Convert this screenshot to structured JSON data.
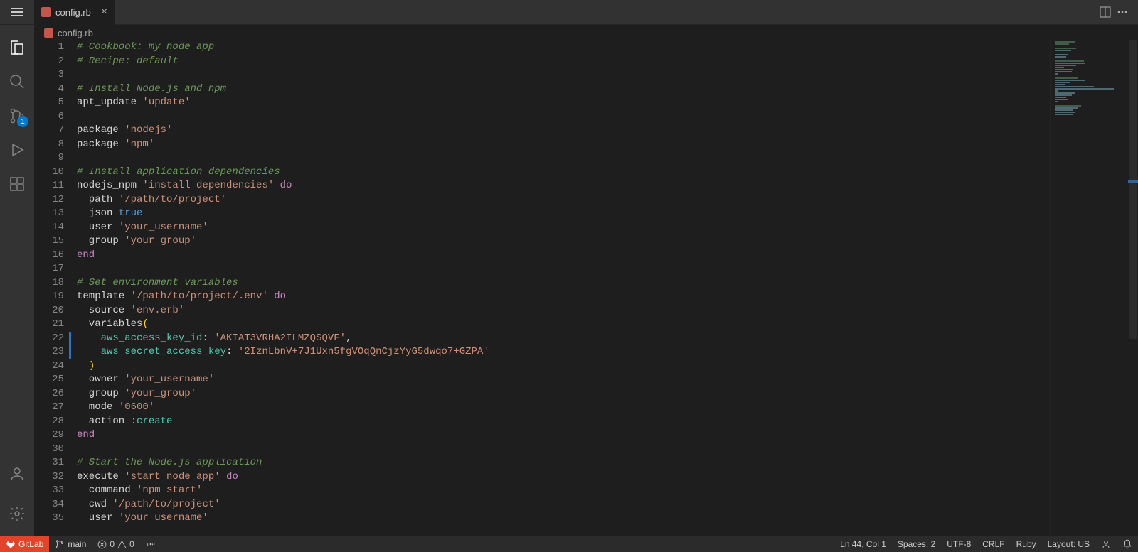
{
  "tab": {
    "filename": "config.rb"
  },
  "breadcrumb": {
    "filename": "config.rb"
  },
  "activitybar": {
    "source_control_badge": "1"
  },
  "statusbar": {
    "gitlab": "GitLab",
    "branch": "main",
    "errors": "0",
    "warnings": "0",
    "cursor": "Ln 44, Col 1",
    "spaces": "Spaces: 2",
    "encoding": "UTF-8",
    "eol": "CRLF",
    "language": "Ruby",
    "layout": "Layout: US"
  },
  "code": [
    {
      "n": 1,
      "t": [
        {
          "c": "c-comment",
          "s": "# Cookbook: my_node_app"
        }
      ]
    },
    {
      "n": 2,
      "t": [
        {
          "c": "c-comment",
          "s": "# Recipe: default"
        }
      ]
    },
    {
      "n": 3,
      "t": []
    },
    {
      "n": 4,
      "t": [
        {
          "c": "c-comment",
          "s": "# Install Node.js and npm"
        }
      ]
    },
    {
      "n": 5,
      "t": [
        {
          "c": "c-ident",
          "s": "apt_update "
        },
        {
          "c": "c-string",
          "s": "'update'"
        }
      ]
    },
    {
      "n": 6,
      "t": []
    },
    {
      "n": 7,
      "t": [
        {
          "c": "c-ident",
          "s": "package "
        },
        {
          "c": "c-string",
          "s": "'nodejs'"
        }
      ]
    },
    {
      "n": 8,
      "t": [
        {
          "c": "c-ident",
          "s": "package "
        },
        {
          "c": "c-string",
          "s": "'npm'"
        }
      ]
    },
    {
      "n": 9,
      "t": []
    },
    {
      "n": 10,
      "t": [
        {
          "c": "c-comment",
          "s": "# Install application dependencies"
        }
      ]
    },
    {
      "n": 11,
      "t": [
        {
          "c": "c-ident",
          "s": "nodejs_npm "
        },
        {
          "c": "c-string",
          "s": "'install dependencies'"
        },
        {
          "c": "c-ident",
          "s": " "
        },
        {
          "c": "c-kw",
          "s": "do"
        }
      ]
    },
    {
      "n": 12,
      "t": [
        {
          "c": "c-ident",
          "s": "  path "
        },
        {
          "c": "c-string",
          "s": "'/path/to/project'"
        }
      ]
    },
    {
      "n": 13,
      "t": [
        {
          "c": "c-ident",
          "s": "  json "
        },
        {
          "c": "c-bool",
          "s": "true"
        }
      ]
    },
    {
      "n": 14,
      "t": [
        {
          "c": "c-ident",
          "s": "  user "
        },
        {
          "c": "c-string",
          "s": "'your_username'"
        }
      ]
    },
    {
      "n": 15,
      "t": [
        {
          "c": "c-ident",
          "s": "  group "
        },
        {
          "c": "c-string",
          "s": "'your_group'"
        }
      ]
    },
    {
      "n": 16,
      "t": [
        {
          "c": "c-kw",
          "s": "end"
        }
      ]
    },
    {
      "n": 17,
      "t": []
    },
    {
      "n": 18,
      "t": [
        {
          "c": "c-comment",
          "s": "# Set environment variables"
        }
      ]
    },
    {
      "n": 19,
      "t": [
        {
          "c": "c-ident",
          "s": "template "
        },
        {
          "c": "c-string",
          "s": "'/path/to/project/.env'"
        },
        {
          "c": "c-ident",
          "s": " "
        },
        {
          "c": "c-kw",
          "s": "do"
        }
      ]
    },
    {
      "n": 20,
      "t": [
        {
          "c": "c-ident",
          "s": "  source "
        },
        {
          "c": "c-string",
          "s": "'env.erb'"
        }
      ]
    },
    {
      "n": 21,
      "t": [
        {
          "c": "c-ident",
          "s": "  variables"
        },
        {
          "c": "c-paren",
          "s": "("
        }
      ]
    },
    {
      "n": 22,
      "dirty": true,
      "t": [
        {
          "c": "c-ident",
          "s": "    "
        },
        {
          "c": "c-symbol",
          "s": "aws_access_key_id"
        },
        {
          "c": "c-ident",
          "s": ": "
        },
        {
          "c": "c-string",
          "s": "'AKIAT3VRHA2ILMZQSQVF'"
        },
        {
          "c": "c-ident",
          "s": ","
        }
      ]
    },
    {
      "n": 23,
      "dirty": true,
      "t": [
        {
          "c": "c-ident",
          "s": "    "
        },
        {
          "c": "c-symbol",
          "s": "aws_secret_access_key"
        },
        {
          "c": "c-ident",
          "s": ": "
        },
        {
          "c": "c-string",
          "s": "'2IznLbnV+7J1Uxn5fgVOqQnCjzYyG5dwqo7+GZPA'"
        }
      ]
    },
    {
      "n": 24,
      "t": [
        {
          "c": "c-ident",
          "s": "  "
        },
        {
          "c": "c-paren",
          "s": ")"
        }
      ]
    },
    {
      "n": 25,
      "t": [
        {
          "c": "c-ident",
          "s": "  owner "
        },
        {
          "c": "c-string",
          "s": "'your_username'"
        }
      ]
    },
    {
      "n": 26,
      "t": [
        {
          "c": "c-ident",
          "s": "  group "
        },
        {
          "c": "c-string",
          "s": "'your_group'"
        }
      ]
    },
    {
      "n": 27,
      "t": [
        {
          "c": "c-ident",
          "s": "  mode "
        },
        {
          "c": "c-string",
          "s": "'0600'"
        }
      ]
    },
    {
      "n": 28,
      "t": [
        {
          "c": "c-ident",
          "s": "  action "
        },
        {
          "c": "c-symbol",
          "s": ":create"
        }
      ]
    },
    {
      "n": 29,
      "t": [
        {
          "c": "c-kw",
          "s": "end"
        }
      ]
    },
    {
      "n": 30,
      "t": []
    },
    {
      "n": 31,
      "t": [
        {
          "c": "c-comment",
          "s": "# Start the Node.js application"
        }
      ]
    },
    {
      "n": 32,
      "t": [
        {
          "c": "c-ident",
          "s": "execute "
        },
        {
          "c": "c-string",
          "s": "'start node app'"
        },
        {
          "c": "c-ident",
          "s": " "
        },
        {
          "c": "c-kw",
          "s": "do"
        }
      ]
    },
    {
      "n": 33,
      "t": [
        {
          "c": "c-ident",
          "s": "  command "
        },
        {
          "c": "c-string",
          "s": "'npm start'"
        }
      ]
    },
    {
      "n": 34,
      "t": [
        {
          "c": "c-ident",
          "s": "  cwd "
        },
        {
          "c": "c-string",
          "s": "'/path/to/project'"
        }
      ]
    },
    {
      "n": 35,
      "t": [
        {
          "c": "c-ident",
          "s": "  user "
        },
        {
          "c": "c-string",
          "s": "'your_username'"
        }
      ]
    }
  ]
}
